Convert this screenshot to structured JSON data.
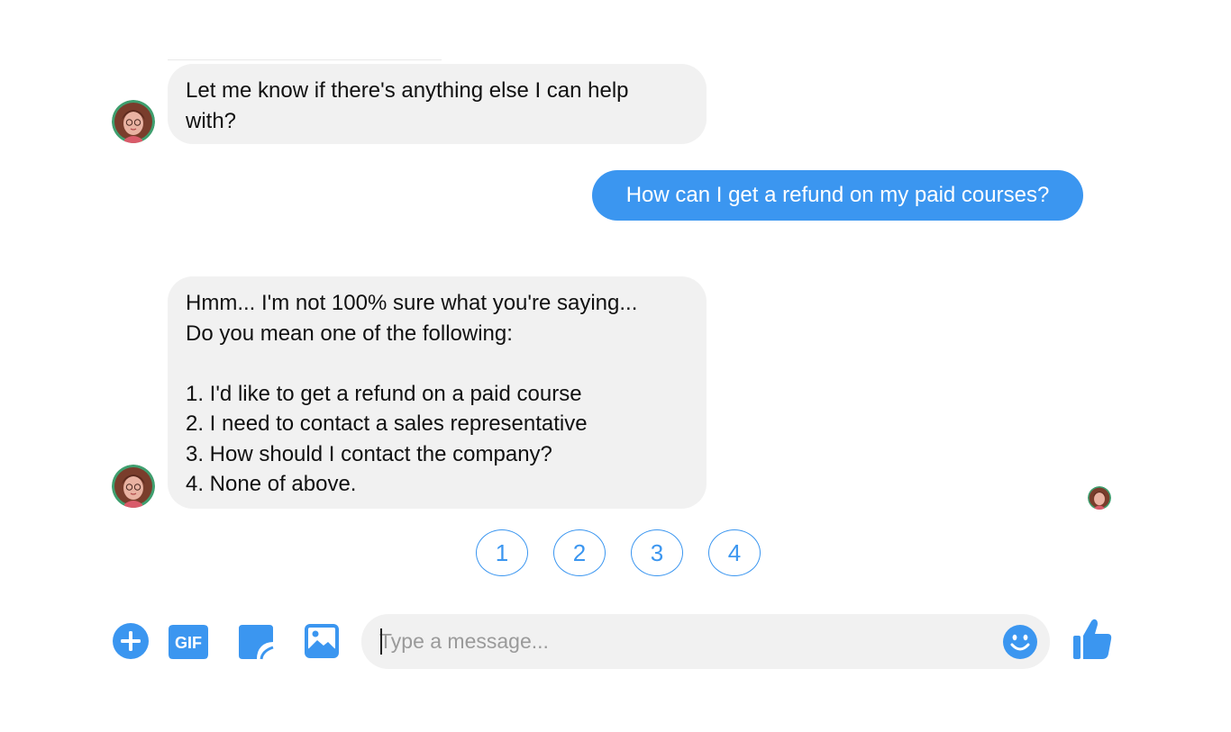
{
  "messages": [
    {
      "sender": "bot",
      "text": "Let me know if there's anything else I can help\nwith?"
    },
    {
      "sender": "user",
      "text": "How can I get a refund on my paid courses?"
    },
    {
      "sender": "bot",
      "text": "Hmm... I'm not 100% sure what you're saying...\nDo you mean one of the following:\n\n1. I'd like to get a refund on a paid course\n2. I need to contact a sales representative\n3. How should I contact the company?\n4. None of above."
    }
  ],
  "quick_replies": [
    "1",
    "2",
    "3",
    "4"
  ],
  "composer": {
    "placeholder": "Type a message...",
    "value": "",
    "icons": [
      "plus-circle-icon",
      "gif-icon",
      "sticker-icon",
      "image-icon",
      "emoji-icon",
      "thumbs-up-icon"
    ],
    "gif_label": "GIF"
  },
  "colors": {
    "accent": "#3b96f0",
    "bot_bubble": "#f1f1f1",
    "user_bubble": "#3b96f0",
    "avatar_ring": "#3f9f6f"
  }
}
